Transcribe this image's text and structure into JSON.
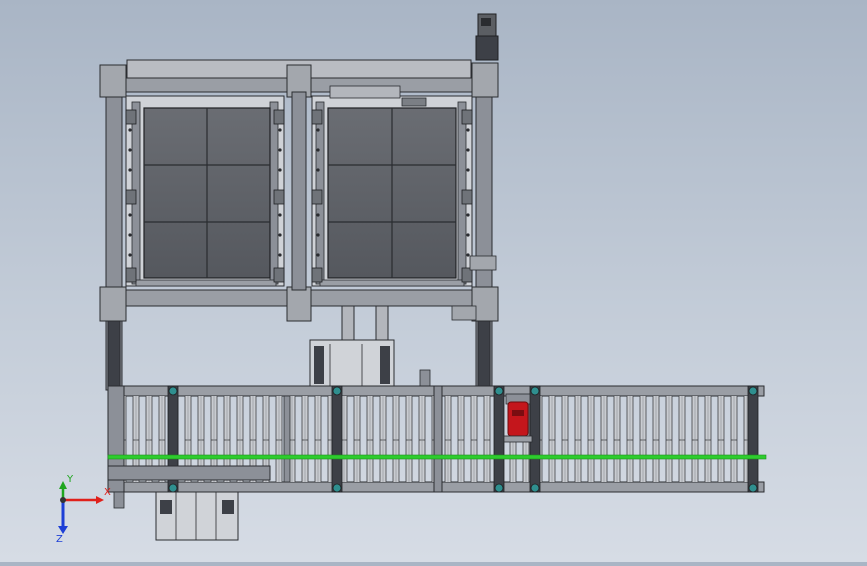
{
  "viewport": {
    "background_top": "#a9b5c5",
    "background_bottom": "#d6dce5",
    "model": {
      "frame_color": "#8c9098",
      "panel_color": "#5d6066",
      "edge_color": "#2a2c30",
      "roller_color": "#c9ccd1",
      "guide_rail_color": "#2ecc2e",
      "gripper_color": "#c4161c",
      "pillar_color": "#3d4047",
      "bolt_color": "#2f8f8f"
    },
    "triad": {
      "x_label": "X",
      "y_label": "Y",
      "z_label": "Z",
      "x_color": "#e0201a",
      "y_color": "#1fa51f",
      "z_color": "#1d3fd6"
    }
  }
}
